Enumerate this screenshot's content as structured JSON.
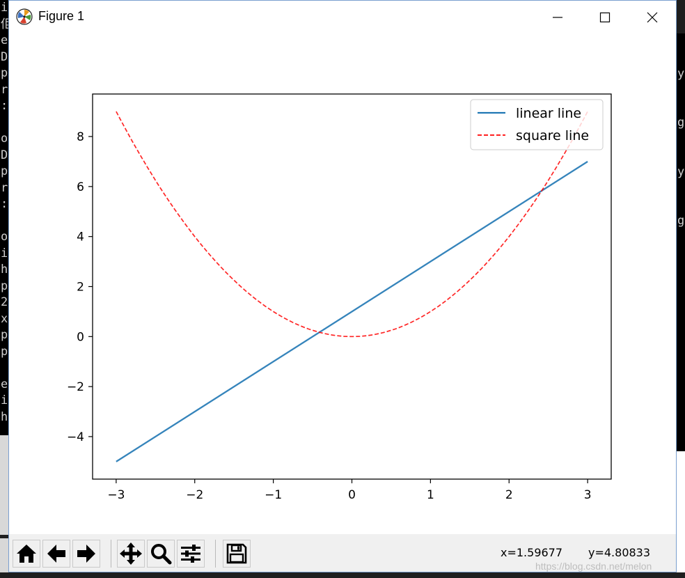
{
  "window": {
    "title": "Figure 1",
    "controls": {
      "minimize": "minimize",
      "maximize": "maximize",
      "close": "close"
    }
  },
  "background": {
    "console_left_chars": [
      "i",
      "佢",
      "e",
      "D",
      "p",
      "r",
      ":",
      "",
      "o",
      "D",
      "p",
      "r",
      ":",
      "",
      "o",
      "i",
      "h",
      "p",
      "2",
      "x",
      "p",
      "p",
      "",
      "e",
      "i",
      "h"
    ],
    "console_right_chars": [
      {
        "ch": "y",
        "row": 1
      },
      {
        "ch": "g",
        "row": 4
      },
      {
        "ch": "y",
        "row": 7
      },
      {
        "ch": "g",
        "row": 10
      }
    ]
  },
  "chart_data": {
    "type": "line",
    "title": "",
    "xlabel": "",
    "ylabel": "",
    "xlim": [
      -3.3,
      3.3
    ],
    "ylim": [
      -5.7,
      9.7
    ],
    "xticks": [
      -3,
      -2,
      -1,
      0,
      1,
      2,
      3
    ],
    "yticks": [
      -4,
      -2,
      0,
      2,
      4,
      6,
      8
    ],
    "grid": false,
    "legend": "top-right",
    "series": [
      {
        "name": "linear line",
        "expression": "y = 2x + 1",
        "style": "solid",
        "color": "#1f77b4",
        "x": [
          -3,
          3
        ],
        "y": [
          -5,
          7
        ]
      },
      {
        "name": "square line",
        "expression": "y = x^2",
        "style": "dashed",
        "color": "#ff0000",
        "x": [
          -3,
          -2.5,
          -2,
          -1.5,
          -1,
          -0.5,
          0,
          0.5,
          1,
          1.5,
          2,
          2.5,
          3
        ],
        "y": [
          9,
          6.25,
          4,
          2.25,
          1,
          0.25,
          0,
          0.25,
          1,
          2.25,
          4,
          6.25,
          9
        ]
      }
    ]
  },
  "toolbar": {
    "buttons": [
      {
        "name": "home-button",
        "icon": "home-icon"
      },
      {
        "name": "back-button",
        "icon": "arrow-left-icon"
      },
      {
        "name": "forward-button",
        "icon": "arrow-right-icon"
      },
      {
        "name": "pan-button",
        "icon": "move-icon"
      },
      {
        "name": "zoom-button",
        "icon": "magnifier-icon"
      },
      {
        "name": "subplots-button",
        "icon": "sliders-icon"
      },
      {
        "name": "save-button",
        "icon": "floppy-icon"
      }
    ],
    "coord_x": "x=1.59677",
    "coord_y": "y=4.80833",
    "watermark": "https://blog.csdn.net/melon"
  }
}
